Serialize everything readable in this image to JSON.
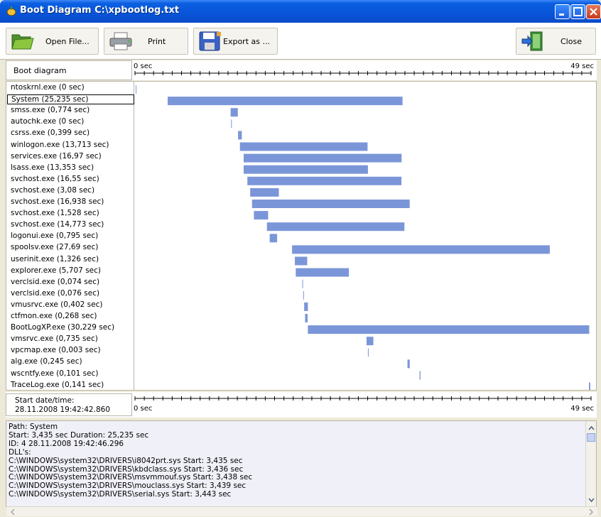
{
  "window": {
    "title": "Boot Diagram C:\\xpbootlog.txt"
  },
  "toolbar": {
    "open_label": "Open File...",
    "print_label": "Print",
    "export_label": "Export as ...",
    "close_label": "Close"
  },
  "ruler": {
    "header_label": "Boot diagram",
    "start_label": "0 sec",
    "end_label": "49 sec",
    "max_sec": 49
  },
  "footer": {
    "start_caption": "Start date/time:",
    "start_value": "28.11.2008 19:42:42.860",
    "start_label": "0 sec",
    "end_label": "49 sec"
  },
  "processes": [
    {
      "label": "ntoskrnl.exe (0 sec)",
      "start": 0,
      "duration": 0
    },
    {
      "label": "System (25,235 sec)",
      "start": 3.435,
      "duration": 25.235,
      "selected": true
    },
    {
      "label": "smss.exe (0,774 sec)",
      "start": 10.2,
      "duration": 0.774
    },
    {
      "label": "autochk.exe (0 sec)",
      "start": 10.25,
      "duration": 0
    },
    {
      "label": "csrss.exe (0,399 sec)",
      "start": 11.0,
      "duration": 0.399
    },
    {
      "label": "winlogon.exe (13,713 sec)",
      "start": 11.2,
      "duration": 13.713
    },
    {
      "label": "services.exe (16,97 sec)",
      "start": 11.6,
      "duration": 16.97
    },
    {
      "label": "lsass.exe (13,353 sec)",
      "start": 11.6,
      "duration": 13.353
    },
    {
      "label": "svchost.exe (16,55 sec)",
      "start": 12.0,
      "duration": 16.55
    },
    {
      "label": "svchost.exe (3,08 sec)",
      "start": 12.3,
      "duration": 3.08
    },
    {
      "label": "svchost.exe (16,938 sec)",
      "start": 12.5,
      "duration": 16.938
    },
    {
      "label": "svchost.exe (1,528 sec)",
      "start": 12.7,
      "duration": 1.528
    },
    {
      "label": "svchost.exe (14,773 sec)",
      "start": 14.1,
      "duration": 14.773
    },
    {
      "label": "logonui.exe (0,795 sec)",
      "start": 14.4,
      "duration": 0.795
    },
    {
      "label": "spoolsv.exe (27,69 sec)",
      "start": 16.8,
      "duration": 27.69
    },
    {
      "label": "userinit.exe (1,326 sec)",
      "start": 17.1,
      "duration": 1.326
    },
    {
      "label": "explorer.exe (5,707 sec)",
      "start": 17.2,
      "duration": 5.707
    },
    {
      "label": "verclsid.exe (0,074 sec)",
      "start": 17.9,
      "duration": 0.074
    },
    {
      "label": "verclsid.exe (0,076 sec)",
      "start": 18.0,
      "duration": 0.076
    },
    {
      "label": "vmusrvc.exe (0,402 sec)",
      "start": 18.1,
      "duration": 0.402
    },
    {
      "label": "ctfmon.exe (0,268 sec)",
      "start": 18.2,
      "duration": 0.268
    },
    {
      "label": "BootLogXP.exe (30,229 sec)",
      "start": 18.5,
      "duration": 30.229
    },
    {
      "label": "vmsrvc.exe (0,735 sec)",
      "start": 24.8,
      "duration": 0.735
    },
    {
      "label": "vpcmap.exe (0,003 sec)",
      "start": 24.95,
      "duration": 0.003
    },
    {
      "label": "alg.exe (0,245 sec)",
      "start": 29.2,
      "duration": 0.245
    },
    {
      "label": "wscntfy.exe (0,101 sec)",
      "start": 30.5,
      "duration": 0.101
    },
    {
      "label": "TraceLog.exe (0,141 sec)",
      "start": 48.7,
      "duration": 0.141
    }
  ],
  "details": {
    "lines": [
      "Path: System",
      "Start: 3,435 sec Duration: 25,235 sec",
      "ID: 4  28.11.2008  19:42:46.296",
      "DLL's:",
      "C:\\WINDOWS\\system32\\DRIVERS\\i8042prt.sys Start: 3,435 sec",
      "C:\\WINDOWS\\system32\\DRIVERS\\kbdclass.sys Start: 3,436 sec",
      "C:\\WINDOWS\\system32\\DRIVERS\\msvmmouf.sys Start: 3,438 sec",
      "C:\\WINDOWS\\system32\\DRIVERS\\mouclass.sys Start: 3,439 sec",
      "C:\\WINDOWS\\system32\\DRIVERS\\serial.sys Start: 3,443 sec"
    ]
  },
  "colors": {
    "bar": "#7b96d8",
    "titlebar": "#0a5fe0",
    "details_bg": "#f0f0f8"
  },
  "icons": [
    "app-icon",
    "open-folder-icon",
    "printer-icon",
    "save-disk-icon",
    "exit-door-icon",
    "minimize-icon",
    "maximize-icon",
    "close-icon",
    "scroll-up-icon",
    "scroll-down-icon",
    "scroll-left-icon",
    "scroll-right-icon"
  ]
}
